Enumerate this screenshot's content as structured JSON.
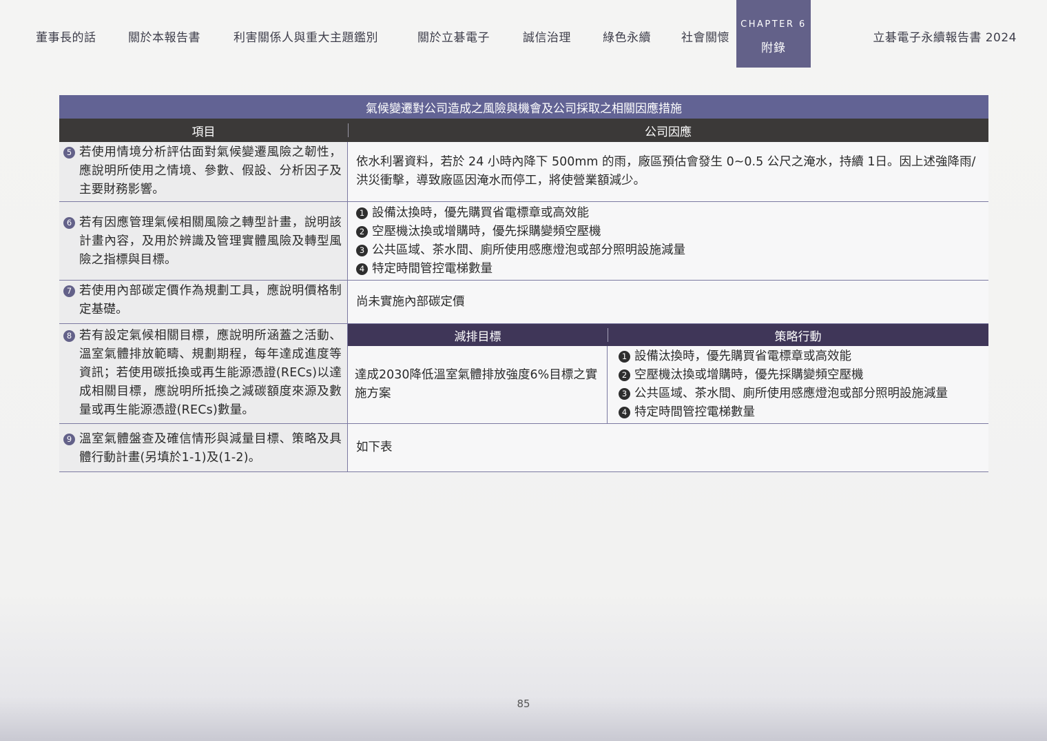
{
  "nav": {
    "items": [
      "董事長的話",
      "關於本報告書",
      "利害關係人與重大主題鑑別",
      "關於立碁電子",
      "誠信治理",
      "綠色永續",
      "社會關懷"
    ],
    "chapter_label": "CHAPTER 6",
    "chapter_name": "附錄",
    "report_title": "立碁電子永續報告書 2024"
  },
  "table": {
    "title": "氣候變遷對公司造成之風險與機會及公司採取之相關因應措施",
    "header_item": "項目",
    "header_response": "公司因應",
    "rows": [
      {
        "num": "5",
        "item": "若使用情境分析評估面對氣候變遷風險之韌性，應說明所使用之情境、參數、假設、分析因子及主要財務影響。",
        "response": "依水利署資料，若於 24 小時內降下 500mm 的雨，廠區預估會發生 0~0.5 公尺之淹水，持續 1日。因上述強降雨/洪災衝擊，導致廠區因淹水而停工，將使營業額減少。"
      },
      {
        "num": "6",
        "item": "若有因應管理氣候相關風險之轉型計畫，說明該計畫內容，及用於辨識及管理實體風險及轉型風險之指標與目標。",
        "bullets": [
          {
            "num": "1",
            "text": "設備汰換時，優先購買省電標章或高效能"
          },
          {
            "num": "2",
            "text": "空壓機汰換或增購時，優先採購變頻空壓機"
          },
          {
            "num": "3",
            "text": "公共區域、茶水間、廁所使用感應燈泡或部分照明設施減量"
          },
          {
            "num": "4",
            "text": "特定時間管控電梯數量"
          }
        ]
      },
      {
        "num": "7",
        "item": "若使用內部碳定價作為規劃工具，應說明價格制定基礎。",
        "response": "尚未實施內部碳定價"
      },
      {
        "num": "8",
        "item": "若有設定氣候相關目標，應說明所涵蓋之活動、溫室氣體排放範疇、規劃期程，每年達成進度等資訊；若使用碳抵換或再生能源憑證(RECs)以達成相關目標，應說明所抵換之減碳額度來源及數量或再生能源憑證(RECs)數量。",
        "sub_header_target": "減排目標",
        "sub_header_action": "策略行動",
        "target": "達成2030降低溫室氣體排放強度6%目標之實施方案",
        "bullets": [
          {
            "num": "1",
            "text": "設備汰換時，優先購買省電標章或高效能"
          },
          {
            "num": "2",
            "text": "空壓機汰換或增購時，優先採購變頻空壓機"
          },
          {
            "num": "3",
            "text": "公共區域、茶水間、廁所使用感應燈泡或部分照明設施減量"
          },
          {
            "num": "4",
            "text": "特定時間管控電梯數量"
          }
        ]
      },
      {
        "num": "9",
        "item": "溫室氣體盤查及確信情形與減量目標、策略及具體行動計畫(另填於1-1)及(1-2)。",
        "response": "如下表"
      }
    ]
  },
  "page_number": "85",
  "colors": {
    "title_bar": "#626394",
    "header_bar": "#3b3938",
    "chapter_tab": "#636189",
    "sub_header": "#3f3658"
  }
}
